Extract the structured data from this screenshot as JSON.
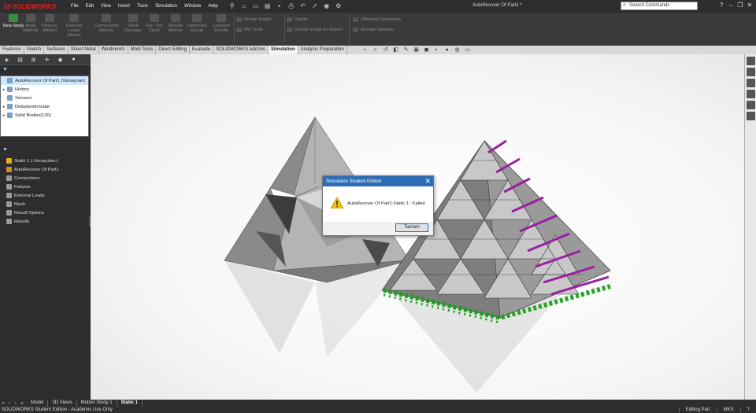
{
  "app": {
    "logo_prefix": "3S",
    "logo": "SOLIDWORKS",
    "document_title": "AutoRecover Of Part1 *",
    "search_placeholder": "Search Commands"
  },
  "menu": [
    "File",
    "Edit",
    "View",
    "Insert",
    "Tools",
    "Simulation",
    "Window",
    "Help"
  ],
  "ribbon": {
    "buttons": [
      {
        "label": "New Study",
        "active": true
      },
      {
        "label": "Apply Material"
      },
      {
        "label": "Fixtures Advisor"
      },
      {
        "label": "External Loads Advisor"
      },
      {
        "label": "Connections Advisor"
      },
      {
        "label": "Shell Manager"
      },
      {
        "label": "Run This Study"
      },
      {
        "label": "Results Advisor"
      },
      {
        "label": "Deformed Result"
      },
      {
        "label": "Compare Results"
      }
    ],
    "small_items": [
      {
        "label": "Design Insight"
      },
      {
        "label": "Plot Tools"
      },
      {
        "label": "Report"
      },
      {
        "label": "Include Image for Report"
      },
      {
        "label": "Offloaded Simulation"
      },
      {
        "label": "Manage Network"
      }
    ]
  },
  "command_tabs": [
    "Features",
    "Sketch",
    "Surfaces",
    "Sheet Metal",
    "Weldments",
    "Mold Tools",
    "Direct Editing",
    "Evaluate",
    "SOLIDWORKS Add-Ins",
    "Simulation",
    "Analysis Preparation"
  ],
  "active_command_tab": "Simulation",
  "feature_tree": {
    "items": [
      {
        "label": "AutoRecover Of Part1  (Varsayılan)",
        "expand": "",
        "selected": true
      },
      {
        "label": "History",
        "expand": "▸"
      },
      {
        "label": "Sensors",
        "expand": ""
      },
      {
        "label": "Detaylandırmalar",
        "expand": "▸"
      },
      {
        "label": "Solid Bodies(130)",
        "expand": "▸"
      }
    ]
  },
  "simulation_tree": {
    "items": [
      {
        "label": "Static 1 (-Varsayılan-)",
        "expand": ""
      },
      {
        "label": "AutoRecover Of Part1",
        "expand": "▸"
      },
      {
        "label": "Connections",
        "expand": "▸"
      },
      {
        "label": "Fixtures",
        "expand": "▸"
      },
      {
        "label": "External Loads",
        "expand": "▸"
      },
      {
        "label": "Mesh",
        "expand": ""
      },
      {
        "label": "Result Options",
        "expand": ""
      },
      {
        "label": "Results",
        "expand": ""
      }
    ]
  },
  "bottom_tabs": [
    "Model",
    "3D Views",
    "Motion Study 1",
    "Static 1"
  ],
  "active_bottom_tab": "Static 1",
  "status": {
    "left": "SOLIDWORKS Student Edition - Academic Use Only",
    "editing": "Editing Part",
    "units": "MKS"
  },
  "dialog": {
    "title": "Simulation Student Edition",
    "message": "AutoRecover Of Part1-Static 1 : Failed",
    "button": "Tamam"
  },
  "colors": {
    "fixture": "#1aa01a",
    "load": "#9b1fa0",
    "dialog_title": "#2d6db5"
  }
}
